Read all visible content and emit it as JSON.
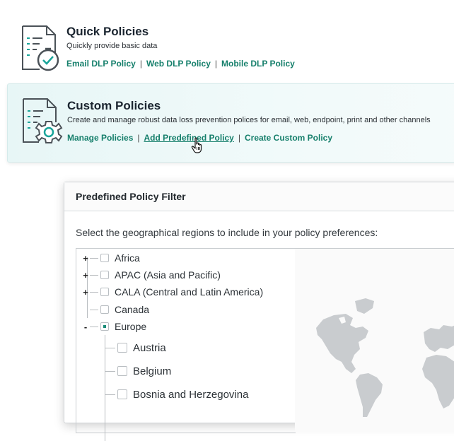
{
  "quick": {
    "title": "Quick Policies",
    "description": "Quickly provide basic data",
    "links": [
      "Email DLP Policy",
      "Web DLP Policy",
      "Mobile DLP Policy"
    ],
    "separator": "|"
  },
  "custom": {
    "title": "Custom Policies",
    "description": "Create and manage robust data loss prevention polices for email, web, endpoint, print and other channels",
    "links": [
      "Manage Policies",
      "Add Predefined Policy",
      "Create Custom Policy"
    ],
    "separator": "|"
  },
  "dialog": {
    "title": "Predefined Policy Filter",
    "instruction": "Select the geographical regions to include in your policy preferences:"
  },
  "regions": [
    {
      "label": "Africa",
      "expander": "+",
      "state": "unchecked"
    },
    {
      "label": "APAC (Asia and Pacific)",
      "expander": "+",
      "state": "unchecked"
    },
    {
      "label": "CALA (Central and Latin America)",
      "expander": "+",
      "state": "unchecked"
    },
    {
      "label": "Canada",
      "expander": "",
      "state": "unchecked"
    },
    {
      "label": "Europe",
      "expander": "-",
      "state": "partial"
    }
  ],
  "europe_children": [
    {
      "label": "Austria",
      "state": "unchecked"
    },
    {
      "label": "Belgium",
      "state": "unchecked"
    },
    {
      "label": "Bosnia and Herzegovina",
      "state": "unchecked"
    }
  ],
  "colors": {
    "accent": "#157f6b",
    "icon_teal": "#1aa59a",
    "custom_card_bg": "#e7f6f6",
    "map_land": "#c9cccf"
  }
}
